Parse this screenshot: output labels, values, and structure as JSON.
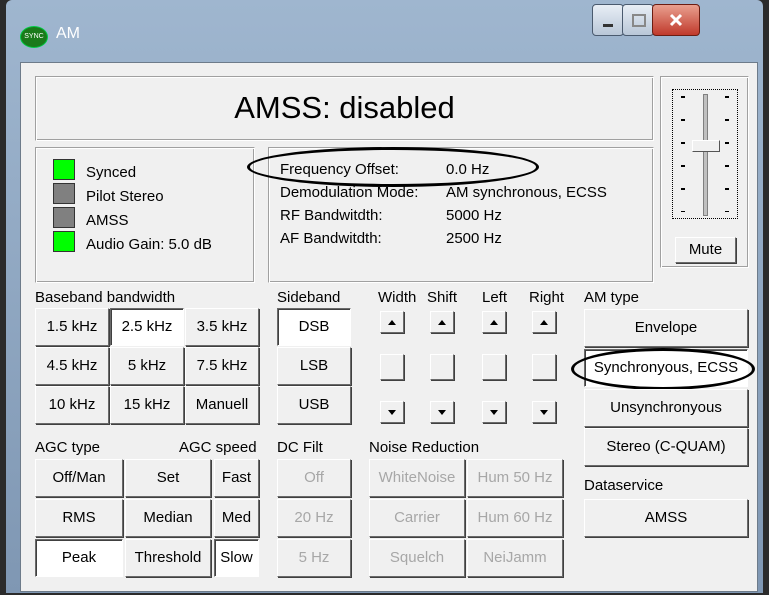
{
  "window": {
    "title": "AM",
    "icon_text": "SYNC"
  },
  "status": {
    "title": "AMSS: disabled"
  },
  "indicators": [
    {
      "label": "Synced",
      "color": "#00ff00"
    },
    {
      "label": "Pilot Stereo",
      "color": "#808080"
    },
    {
      "label": "AMSS",
      "color": "#808080"
    },
    {
      "label": "Audio Gain: 5.0 dB",
      "color": "#00ff00"
    }
  ],
  "info": {
    "freq_label": "Frequency Offset:",
    "freq_value": "0.0 Hz",
    "demod_label": "Demodulation Mode:",
    "demod_value": "AM synchronous, ECSS",
    "rf_label": "RF Bandwitdth:",
    "rf_value": "5000 Hz",
    "af_label": "AF Bandwitdth:",
    "af_value": "2500 Hz"
  },
  "mute_label": "Mute",
  "baseband": {
    "label": "Baseband bandwidth",
    "buttons": [
      "1.5 kHz",
      "2.5 kHz",
      "3.5 kHz",
      "4.5 kHz",
      "5 kHz",
      "7.5 kHz",
      "10 kHz",
      "15 kHz",
      "Manuell"
    ],
    "selected": "2.5 kHz"
  },
  "sideband": {
    "label": "Sideband",
    "buttons": [
      "DSB",
      "LSB",
      "USB"
    ],
    "selected": "DSB"
  },
  "sliders": {
    "width": "Width",
    "shift": "Shift",
    "left": "Left",
    "right": "Right"
  },
  "am_type": {
    "label": "AM type",
    "buttons": [
      "Envelope",
      "Synchronyous, ECSS",
      "Unsynchronyous",
      "Stereo (C-QUAM)"
    ],
    "selected": "Synchronyous, ECSS"
  },
  "agc": {
    "type_label": "AGC type",
    "speed_label": "AGC speed",
    "buttons": [
      "Off/Man",
      "Set",
      "Fast",
      "RMS",
      "Median",
      "Med",
      "Peak",
      "Threshold",
      "Slow"
    ],
    "selected": [
      "Peak",
      "Slow"
    ]
  },
  "dc_filt": {
    "label": "DC Filt",
    "buttons": [
      "Off",
      "20 Hz",
      "5 Hz"
    ]
  },
  "noise": {
    "label": "Noise Reduction",
    "buttons": [
      "WhiteNoise",
      "Hum 50 Hz",
      "Carrier",
      "Hum 60 Hz",
      "Squelch",
      "NeiJamm"
    ]
  },
  "dataservice": {
    "label": "Dataservice",
    "button": "AMSS"
  }
}
